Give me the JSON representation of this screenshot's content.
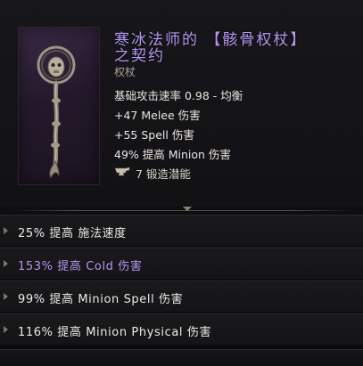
{
  "item": {
    "name": "寒冰法师的 【骸骨权杖】\n之契约",
    "type": "权杖",
    "icon": "bone-scepter-icon"
  },
  "stats": {
    "attack_speed": "基础攻击速率 0.98 - 均衡",
    "melee": "+47 Melee 伤害",
    "spell": "+55 Spell 伤害",
    "minion": "49% 提高 Minion 伤害"
  },
  "forge": {
    "label": "7 锻造潜能",
    "icon": "anvil-icon"
  },
  "affixes": [
    {
      "text": "25% 提高 施法速度"
    },
    {
      "text": "153% 提高 Cold 伤害"
    },
    {
      "text": "99% 提高 Minion Spell 伤害"
    },
    {
      "text": "116% 提高 Minion Physical 伤害"
    }
  ],
  "colors": {
    "title": "#b497f0",
    "cold_affix": "#b497f0",
    "text": "#ecebe7",
    "muted": "#a9a39a"
  }
}
